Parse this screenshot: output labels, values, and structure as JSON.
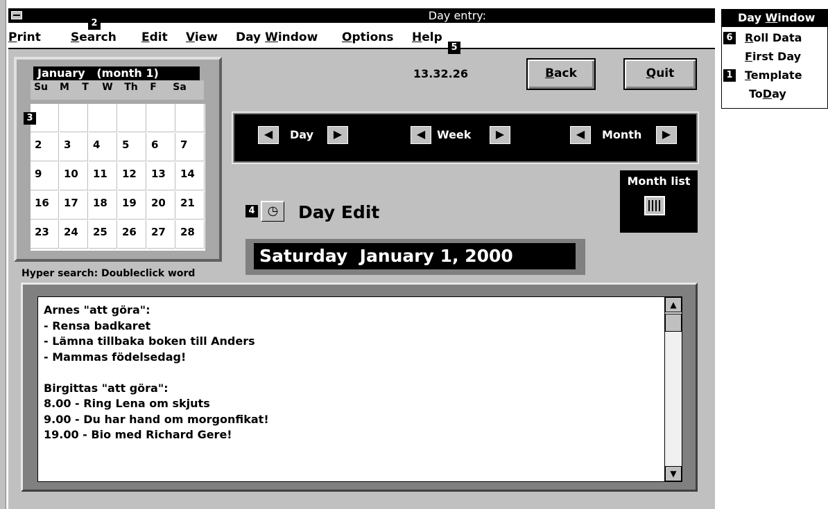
{
  "window": {
    "title": "Day entry:"
  },
  "menu": {
    "items": [
      {
        "label": "Print",
        "u": "P",
        "rest": "rint"
      },
      {
        "label": "Search",
        "u": "S",
        "rest": "earch"
      },
      {
        "label": "Edit",
        "u": "E",
        "rest": "dit"
      },
      {
        "label": "View",
        "u": "V",
        "rest": "iew"
      },
      {
        "label": "Day Window",
        "pre": "Day ",
        "u": "W",
        "rest": "indow"
      },
      {
        "label": "Options",
        "u": "O",
        "rest": "ptions"
      },
      {
        "label": "Help",
        "u": "H",
        "rest": "elp"
      }
    ]
  },
  "badges": [
    "1",
    "2",
    "3",
    "4",
    "5",
    "6"
  ],
  "calendar": {
    "header": "January   (month 1)",
    "day_headers": [
      "Su",
      "M",
      "T",
      "W",
      "Th",
      "F",
      "Sa"
    ],
    "rows": [
      [
        "",
        "",
        "",
        "",
        "",
        ""
      ],
      [
        "2",
        "3",
        "4",
        "5",
        "6",
        "7"
      ],
      [
        "9",
        "10",
        "11",
        "12",
        "13",
        "14"
      ],
      [
        "16",
        "17",
        "18",
        "19",
        "20",
        "21"
      ],
      [
        "23",
        "24",
        "25",
        "26",
        "27",
        "28"
      ]
    ]
  },
  "time": "13.32.26",
  "buttons": {
    "back": {
      "u": "B",
      "rest": "ack"
    },
    "quit": {
      "u": "Q",
      "rest": "uit"
    }
  },
  "nav": {
    "day": "Day",
    "week": "Week",
    "month": "Month"
  },
  "month_list": {
    "label": "Month list"
  },
  "day_edit": {
    "title": "Day Edit"
  },
  "date_display": "Saturday  January 1, 2000",
  "hyper_search": "Hyper search: Doubleclick word",
  "notes": [
    "Arnes \"att göra\":",
    "- Rensa badkaret",
    "- Lämna tillbaka boken till Anders",
    "- Mammas födelsedag!",
    "",
    "Birgittas \"att göra\":",
    "8.00 - Ring Lena om skjuts",
    "9.00 - Du har hand om morgonfikat!",
    "19.00 - Bio med Richard Gere!"
  ],
  "popup": {
    "title": {
      "pre": "Day ",
      "u": "W",
      "rest": "indow"
    },
    "items": [
      {
        "label": "Roll Data",
        "u": "R",
        "rest": "oll Data",
        "pre": ""
      },
      {
        "label": "First Day",
        "u": "F",
        "rest": "irst Day",
        "pre": ""
      },
      {
        "label": "Template",
        "u": "T",
        "rest": "emplate",
        "pre": ""
      },
      {
        "label": "ToDay",
        "pre": "To",
        "u": "D",
        "rest": "ay"
      }
    ]
  }
}
